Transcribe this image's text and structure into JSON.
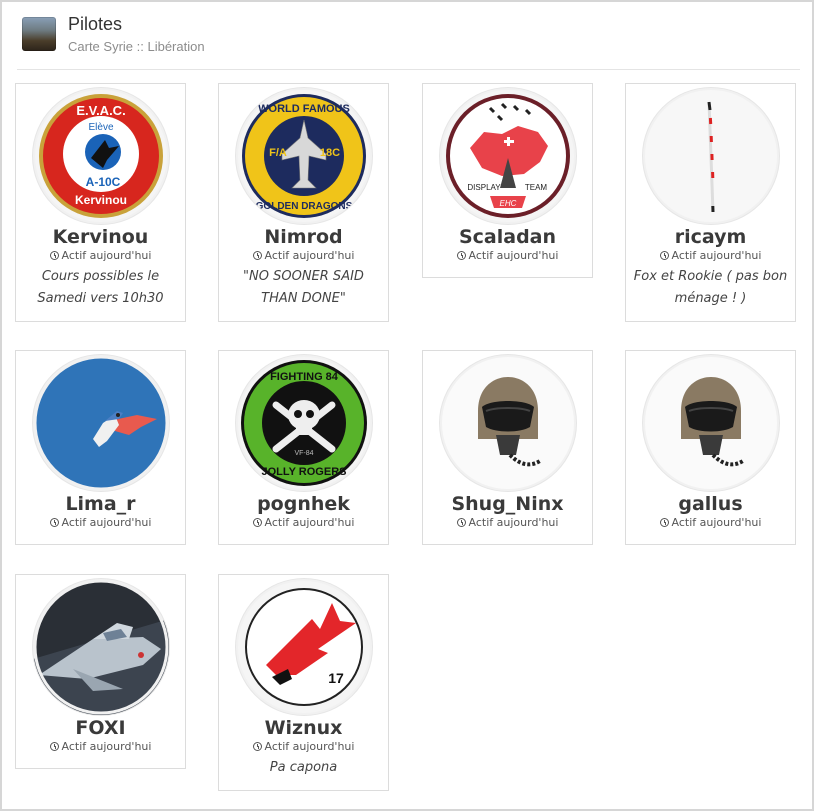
{
  "header": {
    "title": "Pilotes",
    "subtitle": "Carte Syrie :: Libération"
  },
  "status_label": "Actif aujourd'hui",
  "members": [
    {
      "name": "Kervinou",
      "status": "Actif aujourd'hui",
      "motto": "Cours possibles le Samedi vers 10h30",
      "avatar": "evac-a10c-patch"
    },
    {
      "name": "Nimrod",
      "status": "Actif aujourd'hui",
      "motto": "\"NO SOONER SAID THAN DONE\"",
      "avatar": "golden-dragons-patch"
    },
    {
      "name": "Scaladan",
      "status": "Actif aujourd'hui",
      "motto": "",
      "avatar": "display-team-patch"
    },
    {
      "name": "ricaym",
      "status": "Actif aujourd'hui",
      "motto": "Fox et Rookie ( pas bon ménage ! )",
      "avatar": "white-cane"
    },
    {
      "name": "Lima_r",
      "status": "Actif aujourd'hui",
      "motto": "",
      "avatar": "bird-sky"
    },
    {
      "name": "pognhek",
      "status": "Actif aujourd'hui",
      "motto": "",
      "avatar": "jolly-rogers-patch"
    },
    {
      "name": "Shug_Ninx",
      "status": "Actif aujourd'hui",
      "motto": "",
      "avatar": "pilot-helmet"
    },
    {
      "name": "gallus",
      "status": "Actif aujourd'hui",
      "motto": "",
      "avatar": "pilot-helmet"
    },
    {
      "name": "FOXI",
      "status": "Actif aujourd'hui",
      "motto": "",
      "avatar": "mirage-jet"
    },
    {
      "name": "Wiznux",
      "status": "Actif aujourd'hui",
      "motto": "Pa capona",
      "avatar": "red-bird-17-patch"
    }
  ],
  "patch_text": {
    "evac_top": "E.V.A.C.",
    "evac_mid": "Elève",
    "evac_model": "A-10C",
    "evac_bottom": "Kervinou",
    "dragons_top": "WORLD FAMOUS",
    "dragons_left": "F/A",
    "dragons_right": "18C",
    "dragons_bottom": "GOLDEN DRAGONS",
    "display_left": "DISPLAY",
    "display_right": "TEAM",
    "display_ribbon": "EHC",
    "rogers_top": "FIGHTING 84",
    "rogers_mid": "VF-84",
    "rogers_bottom": "JOLLY ROGERS",
    "bird_number": "17"
  },
  "colors": {
    "evac_red": "#d7261e",
    "evac_blue": "#1a63b8",
    "dragons_navy": "#1d2b5e",
    "dragons_gold": "#f0c419",
    "swiss_red": "#e8424a",
    "rogers_green": "#58b32a",
    "sky_blue": "#2f74b8",
    "wiz_red": "#e3262a"
  }
}
